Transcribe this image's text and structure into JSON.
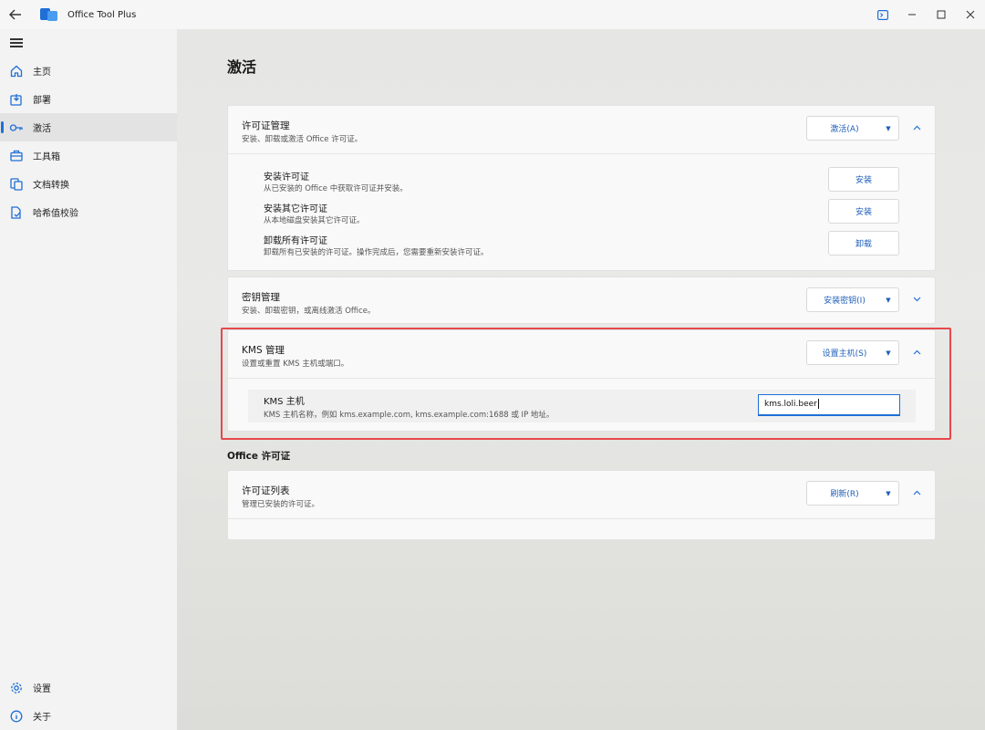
{
  "titlebar": {
    "app_title": "Office Tool Plus",
    "back_icon": "arrow-left-icon",
    "controls": [
      "terminal-icon",
      "minimize-icon",
      "maximize-icon",
      "close-icon"
    ]
  },
  "sidebar": {
    "items": [
      {
        "label": "主页",
        "icon": "home-icon"
      },
      {
        "label": "部署",
        "icon": "deploy-icon"
      },
      {
        "label": "激活",
        "icon": "key-icon",
        "active": true
      },
      {
        "label": "工具箱",
        "icon": "toolbox-icon"
      },
      {
        "label": "文档转换",
        "icon": "document-convert-icon"
      },
      {
        "label": "哈希值校验",
        "icon": "hash-check-icon"
      }
    ],
    "bottom_items": [
      {
        "label": "设置",
        "icon": "gear-icon"
      },
      {
        "label": "关于",
        "icon": "info-icon"
      }
    ]
  },
  "page": {
    "title": "激活",
    "license_mgmt": {
      "title": "许可证管理",
      "subtitle": "安装、卸载或激活 Office 许可证。",
      "button": "激活(A)",
      "rows": [
        {
          "title": "安装许可证",
          "subtitle": "从已安装的 Office 中获取许可证并安装。",
          "button": "安装"
        },
        {
          "title": "安装其它许可证",
          "subtitle": "从本地磁盘安装其它许可证。",
          "button": "安装"
        },
        {
          "title": "卸载所有许可证",
          "subtitle": "卸载所有已安装的许可证。操作完成后，您需要重新安装许可证。",
          "button": "卸载"
        }
      ]
    },
    "key_mgmt": {
      "title": "密钥管理",
      "subtitle": "安装、卸载密钥，或离线激活 Office。",
      "button": "安装密钥(I)"
    },
    "kms_mgmt": {
      "title": "KMS 管理",
      "subtitle": "设置或重置 KMS 主机或端口。",
      "button": "设置主机(S)",
      "host_title": "KMS 主机",
      "host_subtitle": "KMS 主机名称，例如 kms.example.com, kms.example.com:1688 或 IP 地址。",
      "host_value": "kms.loli.beer"
    },
    "office_license_label": "Office 许可证",
    "license_list": {
      "title": "许可证列表",
      "subtitle": "管理已安装的许可证。",
      "button": "刷新(R)"
    }
  },
  "colors": {
    "accent": "#1f6fd6",
    "highlight": "#e5484d"
  }
}
